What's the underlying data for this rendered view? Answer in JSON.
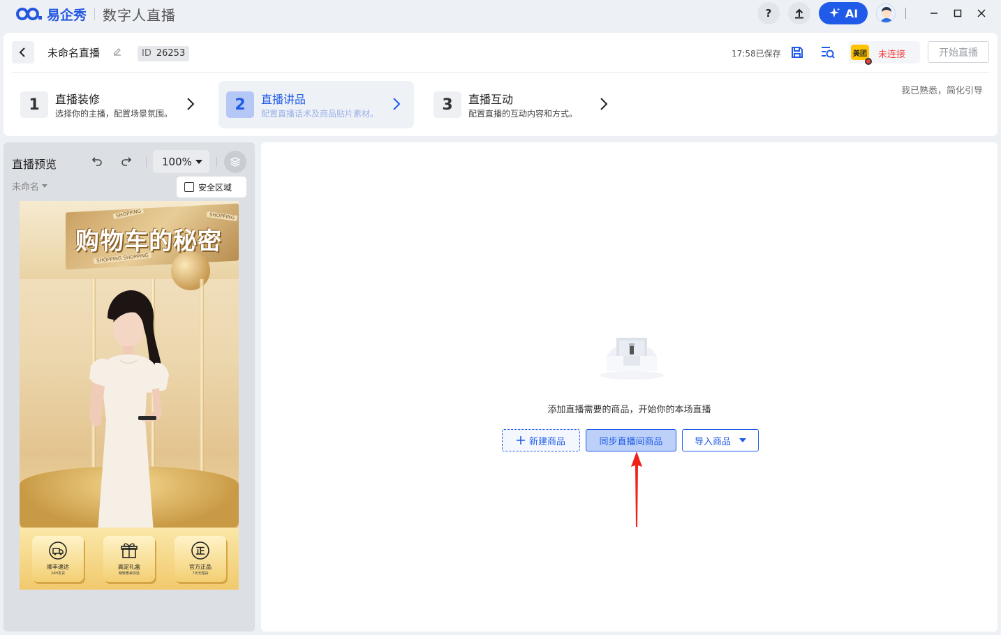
{
  "app": {
    "logo_text": "易企秀",
    "name": "数字人直播"
  },
  "titlebar": {
    "help_label": "?",
    "ai_label": "AI"
  },
  "header": {
    "title": "未命名直播",
    "id_key": "ID",
    "id_value": "26253",
    "save_status": "17:58已保存",
    "platform_label": "美团",
    "connection_status": "未连接",
    "start_button": "开始直播",
    "skip_guide": "我已熟悉，简化引导"
  },
  "steps": [
    {
      "num": "1",
      "title": "直播装修",
      "desc": "选择你的主播，配置场景氛围。"
    },
    {
      "num": "2",
      "title": "直播讲品",
      "desc": "配置直播话术及商品贴片素材。"
    },
    {
      "num": "3",
      "title": "直播互动",
      "desc": "配置直播的互动内容和方式。"
    }
  ],
  "preview": {
    "title": "直播预览",
    "zoom": "100%",
    "scene_name": "未命名",
    "safe_area_label": "安全区域",
    "canvas": {
      "title": "购物车的秘密",
      "tag_top": "SHOPPING",
      "tag_right": "SHOPPING",
      "tag_bottom": "SHOPPING SHOPPING",
      "features": [
        {
          "label": "顺丰速达",
          "sub": "24H发货"
        },
        {
          "label": "高定礼盒",
          "sub": "精致奢美体验"
        },
        {
          "label": "官方正品",
          "sub": "7天无理由"
        }
      ],
      "feature_glyph_3": "正"
    }
  },
  "main": {
    "empty_text": "添加直播需要的商品，开始你的本场直播",
    "new_button": "新建商品",
    "sync_button": "同步直播间商品",
    "import_button": "导入商品"
  },
  "colors": {
    "accent": "#1f5be8",
    "danger": "#f04141",
    "panel_bg": "#dcdfe4"
  }
}
